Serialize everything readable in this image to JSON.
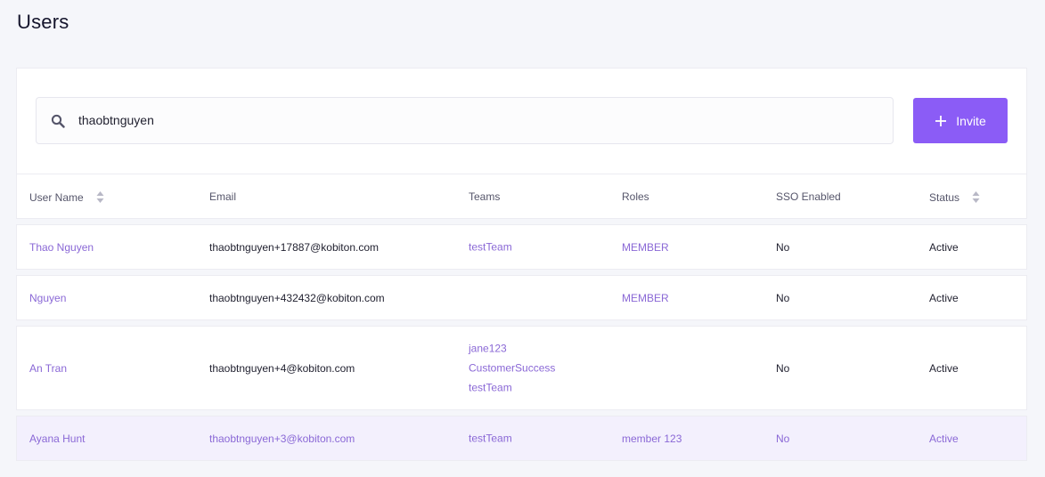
{
  "page": {
    "title": "Users"
  },
  "search": {
    "value": "thaobtnguyen"
  },
  "invite": {
    "label": "Invite"
  },
  "columns": {
    "user_name": "User Name",
    "email": "Email",
    "teams": "Teams",
    "roles": "Roles",
    "sso": "SSO Enabled",
    "status": "Status"
  },
  "users": [
    {
      "name": "Thao Nguyen",
      "email": "thaobtnguyen+17887@kobiton.com",
      "teams": [
        "testTeam"
      ],
      "role": "MEMBER",
      "sso": "No",
      "status": "Active"
    },
    {
      "name": "Nguyen",
      "email": "thaobtnguyen+432432@kobiton.com",
      "teams": [],
      "role": "MEMBER",
      "sso": "No",
      "status": "Active"
    },
    {
      "name": "An Tran",
      "email": "thaobtnguyen+4@kobiton.com",
      "teams": [
        "jane123",
        "CustomerSuccess",
        "testTeam"
      ],
      "role": "",
      "sso": "No",
      "status": "Active"
    },
    {
      "name": "Ayana Hunt",
      "email": "thaobtnguyen+3@kobiton.com",
      "teams": [
        "testTeam"
      ],
      "role": "member 123",
      "sso": "No",
      "status": "Active"
    }
  ],
  "colors": {
    "accent": "#8b5cf6",
    "link": "#8a68d6",
    "hover_row": "#f3f0fd"
  }
}
